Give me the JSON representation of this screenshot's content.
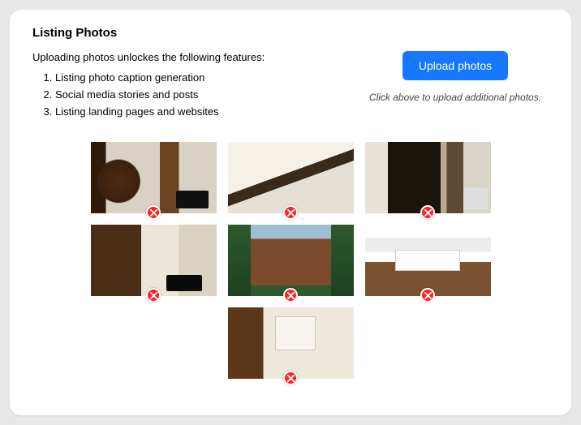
{
  "title": "Listing Photos",
  "intro": "Uploading photos unlockes the following features:",
  "features": [
    "Listing photo caption generation",
    "Social media stories and posts",
    "Listing landing pages and websites"
  ],
  "upload_button_label": "Upload photos",
  "upload_caption": "Click above to upload additional photos.",
  "photos": [
    {
      "alt": "Interior room with wooden door and radiator"
    },
    {
      "alt": "Staircase landing looking down"
    },
    {
      "alt": "Hallway with dark corridor and couch"
    },
    {
      "alt": "Room with wooden door and heater"
    },
    {
      "alt": "Brick house exterior with trees"
    },
    {
      "alt": "Bathroom sink with wood vanity"
    },
    {
      "alt": "Living room with wood door and window"
    }
  ]
}
